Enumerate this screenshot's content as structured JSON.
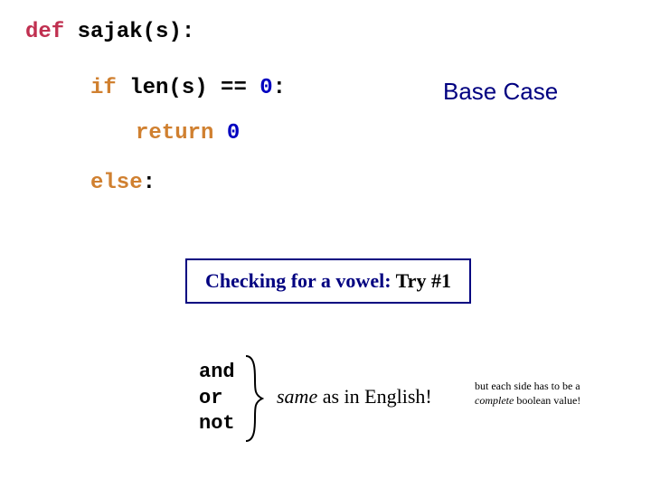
{
  "code": {
    "def": "def",
    "func": "sajak(s)",
    "if": "if",
    "cond": "len(s) == ",
    "zero": "0",
    "return": "return",
    "ret_zero": "0",
    "else": "else"
  },
  "labels": {
    "base_case": "Base Case"
  },
  "vowel": {
    "lead": "Checking for a vowel:",
    "tail": "  Try #1"
  },
  "ops": {
    "and": "and",
    "or": " or",
    "not": "not"
  },
  "english": {
    "same": "same",
    "rest": " as in English!"
  },
  "footnote": {
    "l1a": "but each side has to be a ",
    "l1b": "complete",
    "l1c": " boolean value!"
  }
}
